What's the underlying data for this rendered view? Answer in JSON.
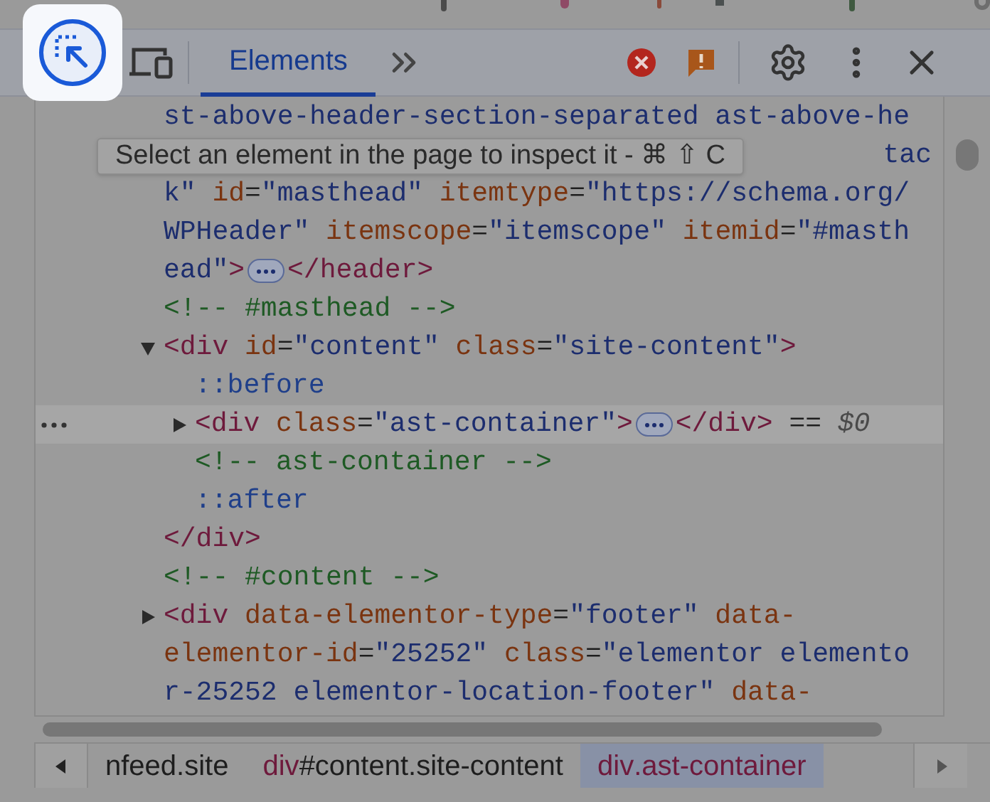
{
  "toolbar": {
    "tabs": [
      {
        "label": "Elements",
        "selected": true
      }
    ]
  },
  "tooltip": {
    "text": "Select an element in the page to inspect it - ⌘ ⇧ C"
  },
  "dom_lines": [
    {
      "kind": "line",
      "selected": false,
      "tokens": [
        {
          "kind": "value",
          "text": "st-above-header-section-separated ast-above-he"
        }
      ]
    },
    {
      "kind": "tail",
      "selected": false,
      "tokens": [
        {
          "kind": "value",
          "text": "tac"
        }
      ]
    },
    {
      "kind": "line",
      "selected": false,
      "tokens": [
        {
          "kind": "value",
          "text": "k\""
        },
        {
          "kind": "attr",
          "text": " id"
        },
        {
          "kind": "plain",
          "text": "="
        },
        {
          "kind": "value",
          "text": "\"masthead\""
        },
        {
          "kind": "attr",
          "text": " itemtype"
        },
        {
          "kind": "plain",
          "text": "="
        },
        {
          "kind": "value",
          "text": "\"https://schema.org/"
        }
      ]
    },
    {
      "kind": "line",
      "selected": false,
      "tokens": [
        {
          "kind": "value",
          "text": "WPHeader\""
        },
        {
          "kind": "attr",
          "text": " itemscope"
        },
        {
          "kind": "plain",
          "text": "="
        },
        {
          "kind": "value",
          "text": "\"itemscope\""
        },
        {
          "kind": "attr",
          "text": " itemid"
        },
        {
          "kind": "plain",
          "text": "="
        },
        {
          "kind": "value",
          "text": "\"#masth"
        }
      ]
    },
    {
      "kind": "line",
      "selected": false,
      "tokens": [
        {
          "kind": "value",
          "text": "ead\""
        },
        {
          "kind": "tag",
          "text": ">"
        },
        {
          "kind": "badge"
        },
        {
          "kind": "tag",
          "text": "</header>"
        }
      ]
    },
    {
      "kind": "line",
      "selected": false,
      "tokens": [
        {
          "kind": "comment",
          "text": "<!-- #masthead -->"
        }
      ]
    },
    {
      "kind": "element",
      "selected": false,
      "expanded": true,
      "tokens": [
        {
          "kind": "tag",
          "text": "<div"
        },
        {
          "kind": "attr",
          "text": " id"
        },
        {
          "kind": "plain",
          "text": "="
        },
        {
          "kind": "value",
          "text": "\"content\""
        },
        {
          "kind": "attr",
          "text": " class"
        },
        {
          "kind": "plain",
          "text": "="
        },
        {
          "kind": "value",
          "text": "\"site-content\""
        },
        {
          "kind": "tag",
          "text": ">"
        }
      ],
      "children": [
        {
          "kind": "line",
          "selected": false,
          "tokens": [
            {
              "kind": "pseudo",
              "text": "::before"
            }
          ]
        },
        {
          "kind": "element",
          "selected": true,
          "expanded": false,
          "tokens": [
            {
              "kind": "tag",
              "text": "<div"
            },
            {
              "kind": "attr",
              "text": " class"
            },
            {
              "kind": "plain",
              "text": "="
            },
            {
              "kind": "value",
              "text": "\"ast-container\""
            },
            {
              "kind": "tag",
              "text": ">"
            },
            {
              "kind": "badge"
            },
            {
              "kind": "tag",
              "text": "</div>"
            },
            {
              "kind": "plain",
              "text": " == "
            },
            {
              "kind": "var",
              "text": "$0"
            }
          ]
        },
        {
          "kind": "line",
          "selected": false,
          "tokens": [
            {
              "kind": "comment",
              "text": "<!-- ast-container -->"
            }
          ]
        },
        {
          "kind": "line",
          "selected": false,
          "tokens": [
            {
              "kind": "pseudo",
              "text": "::after"
            }
          ]
        }
      ]
    },
    {
      "kind": "line",
      "selected": false,
      "tokens": [
        {
          "kind": "tag",
          "text": "</div>"
        }
      ]
    },
    {
      "kind": "line",
      "selected": false,
      "tokens": [
        {
          "kind": "comment",
          "text": "<!-- #content -->"
        }
      ]
    },
    {
      "kind": "element",
      "selected": false,
      "expanded": false,
      "tokens": [
        {
          "kind": "tag",
          "text": "<div"
        },
        {
          "kind": "attr",
          "text": " data-elementor-type"
        },
        {
          "kind": "plain",
          "text": "="
        },
        {
          "kind": "value",
          "text": "\"footer\""
        },
        {
          "kind": "attr",
          "text": " data-"
        }
      ]
    },
    {
      "kind": "line",
      "selected": false,
      "tokens": [
        {
          "kind": "attr",
          "text": "elementor-id"
        },
        {
          "kind": "plain",
          "text": "="
        },
        {
          "kind": "value",
          "text": "\"25252\""
        },
        {
          "kind": "attr",
          "text": " class"
        },
        {
          "kind": "plain",
          "text": "="
        },
        {
          "kind": "value",
          "text": "\"elementor elemento"
        }
      ]
    },
    {
      "kind": "line",
      "selected": false,
      "tokens": [
        {
          "kind": "value",
          "text": "r-25252 elementor-location-footer\""
        },
        {
          "kind": "attr",
          "text": " data-"
        }
      ]
    }
  ],
  "breadcrumbs": [
    {
      "rest": "nfeed.site",
      "selected": false
    },
    {
      "tag": "div",
      "rest": "#content.site-content",
      "selected": false
    },
    {
      "tag": "div",
      "rest": ".ast-container",
      "selected": true
    }
  ]
}
